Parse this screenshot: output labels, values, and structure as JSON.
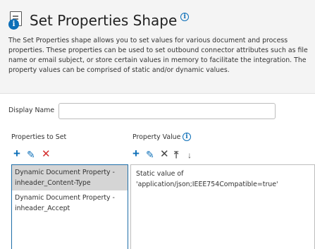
{
  "title": "Set Properties Shape",
  "description": "The Set Properties shape allows you to set values for various document and process properties. These properties can be used to set outbound connector attributes such as file name or email subject, or store certain values in memory to facilitate the integration. The property values can be comprised of static and/or dynamic values.",
  "display_name": {
    "label": "Display Name",
    "value": ""
  },
  "properties": {
    "label": "Properties to Set",
    "items": [
      {
        "label": "Dynamic Document Property - inheader_Content-Type",
        "selected": true
      },
      {
        "label": "Dynamic Document Property - inheader_Accept",
        "selected": false
      }
    ]
  },
  "property_value": {
    "label": "Property Value",
    "text": "Static value of 'application/json;IEEE754Compatible=true'"
  },
  "icons": {
    "add": "+",
    "edit": "✎",
    "delete": "✕",
    "move_top": "⤒",
    "move_down": "↓",
    "info": "i"
  },
  "colors": {
    "accent": "#0d6fb8",
    "delete_red": "#d42c2c",
    "header_bg": "#f4f4f4",
    "selected_bg": "#d5d5d5"
  }
}
